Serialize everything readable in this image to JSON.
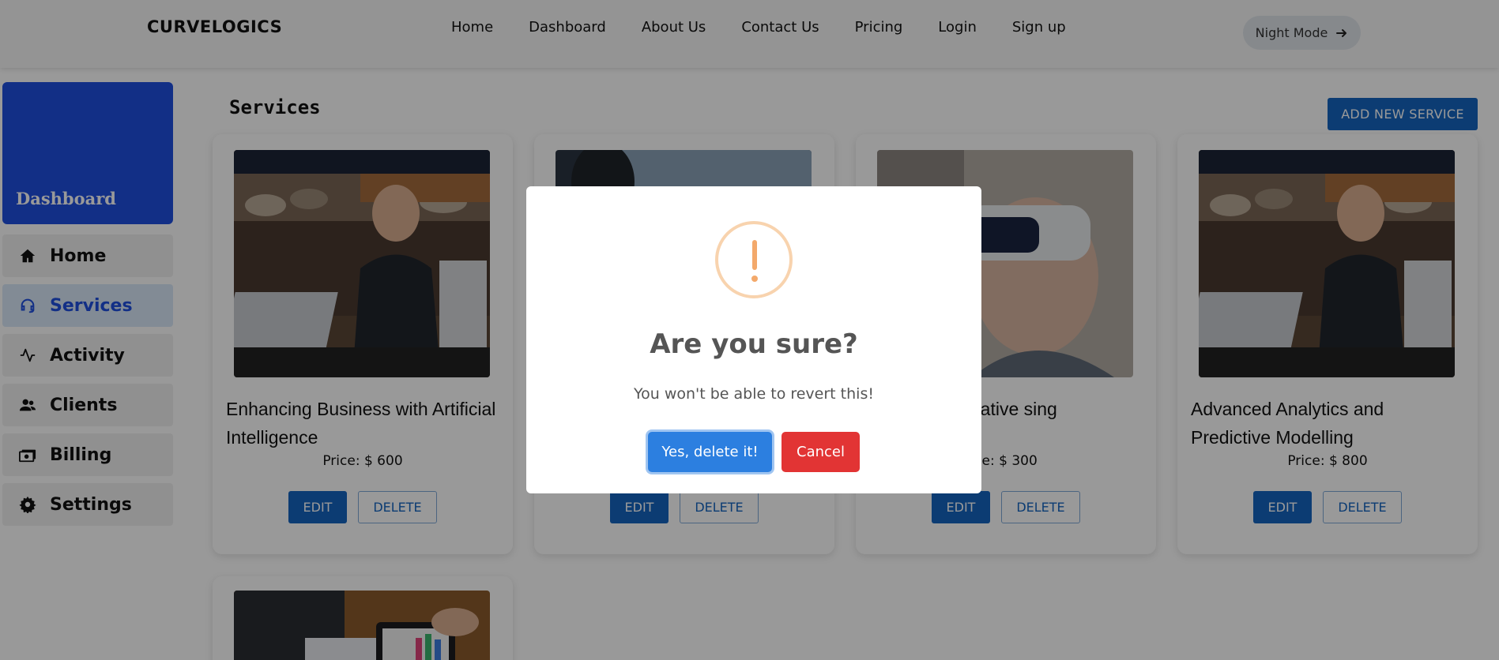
{
  "brand": "CURVELOGICS",
  "nav": {
    "items": [
      "Home",
      "Dashboard",
      "About Us",
      "Contact Us",
      "Pricing",
      "Login",
      "Sign up"
    ],
    "night_mode": "Night Mode"
  },
  "sidebar": {
    "header": "Dashboard",
    "items": [
      {
        "label": "Home",
        "icon": "home-icon"
      },
      {
        "label": "Services",
        "icon": "headset-icon",
        "active": true
      },
      {
        "label": "Activity",
        "icon": "activity-icon"
      },
      {
        "label": "Clients",
        "icon": "users-icon"
      },
      {
        "label": "Billing",
        "icon": "money-icon"
      },
      {
        "label": "Settings",
        "icon": "gear-icon"
      }
    ]
  },
  "main": {
    "title": "Services",
    "add_button": "ADD NEW SERVICE",
    "cards": [
      {
        "title": "Enhancing Business with Artificial Intelligence",
        "price": "Price: $ 600",
        "edit": "EDIT",
        "delete": "DELETE"
      },
      {
        "title": "",
        "price": "",
        "edit": "EDIT",
        "delete": "DELETE"
      },
      {
        "title": "on and Generative sing",
        "price": "ce: $ 300",
        "edit": "EDIT",
        "delete": "DELETE"
      },
      {
        "title": "Advanced Analytics and Predictive Modelling",
        "price": "Price: $ 800",
        "edit": "EDIT",
        "delete": "DELETE"
      }
    ]
  },
  "modal": {
    "title": "Are you sure?",
    "text": "You won't be able to revert this!",
    "confirm": "Yes, delete it!",
    "cancel": "Cancel"
  }
}
